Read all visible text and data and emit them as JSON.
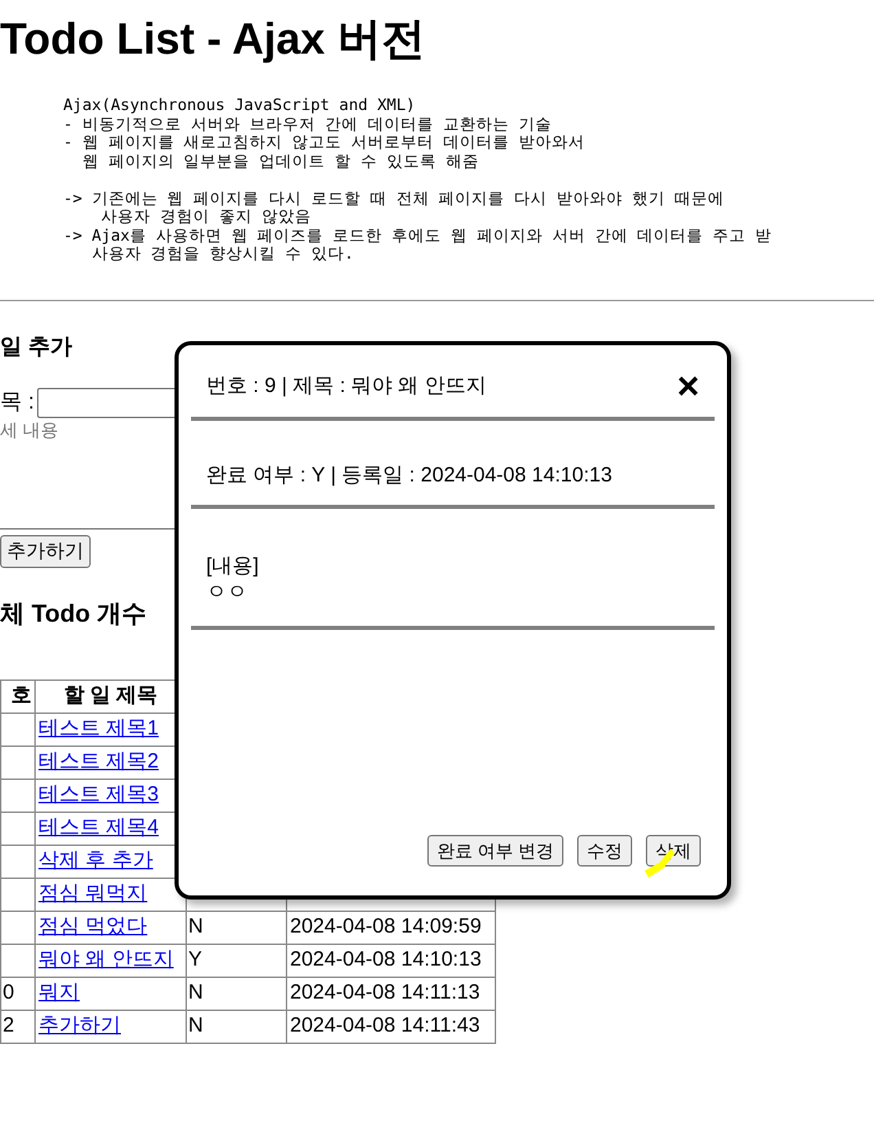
{
  "page": {
    "title": "Todo List - Ajax 버전",
    "description": "Ajax(Asynchronous JavaScript and XML)\n- 비동기적으로 서버와 브라우저 간에 데이터를 교환하는 기술\n- 웹 페이지를 새로고침하지 않고도 서버로부터 데이터를 받아와서\n  웹 페이지의 일부분을 업데이트 할 수 있도록 해줌\n\n-> 기존에는 웹 페이지를 다시 로드할 때 전체 페이지를 다시 받아와야 했기 때문에\n    사용자 경험이 좋지 않았음\n-> Ajax를 사용하면 웹 페이즈를 로드한 후에도 웹 페이지와 서버 간에 데이터를 주고 받\n   사용자 경험을 향상시킬 수 있다."
  },
  "add_form": {
    "heading": "일 추가",
    "title_label": "목 :",
    "content_placeholder": "세 내용",
    "submit_button": "추가하기"
  },
  "count_heading": "체 Todo 개수",
  "table": {
    "columns": [
      "호",
      "할 일 제목"
    ],
    "rows": [
      {
        "title": "테스트 제목1"
      },
      {
        "title": "테스트 제목2"
      },
      {
        "title": "테스트 제목3"
      },
      {
        "title": "테스트 제목4"
      },
      {
        "title": "삭제 후 추가"
      },
      {
        "title": "점심 뭐먹지"
      },
      {
        "title": "점심 먹었다",
        "done": "N",
        "date": "2024-04-08 14:09:59"
      },
      {
        "title": "뭐야 왜 안뜨지",
        "done": "Y",
        "date": "2024-04-08 14:10:13"
      },
      {
        "number": "0",
        "title": "뭐지",
        "done": "N",
        "date": "2024-04-08 14:11:13"
      },
      {
        "number": "2",
        "title": "추가하기",
        "done": "N",
        "date": "2024-04-08 14:11:43"
      }
    ]
  },
  "modal": {
    "header": "번호 : 9 | 제목 : 뭐야 왜 안뜨지",
    "close": "×",
    "info": "완료 여부 : Y | 등록일 : 2024-04-08 14:10:13",
    "content_label": "[내용]",
    "content": "ㅇㅇ",
    "buttons": [
      {
        "label": "완료 여부 변경",
        "highlighted": false
      },
      {
        "label": "수정",
        "highlighted": false
      },
      {
        "label": "삭제",
        "highlighted": true
      }
    ]
  }
}
